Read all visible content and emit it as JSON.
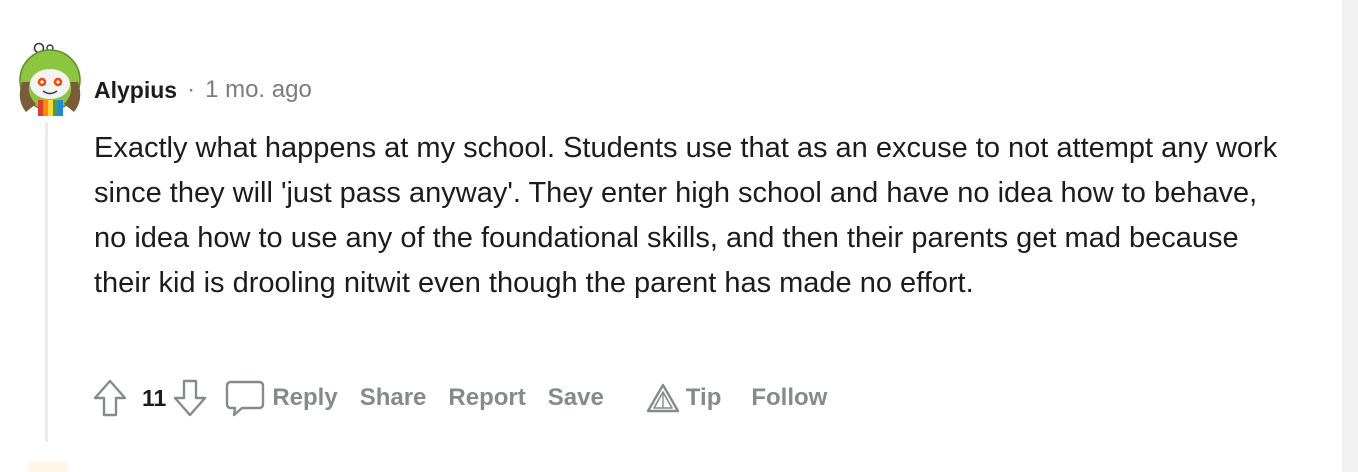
{
  "comment": {
    "author": "Alypius",
    "separator": "·",
    "time": "1 mo. ago",
    "body": "Exactly what happens at my school. Students use that as an excuse to not attempt any work since they will 'just pass anyway'. They enter high school and have no idea how to behave, no idea how to use any of the foundational skills, and then their parents get mad because their kid is drooling nitwit even though the parent has made no effort.",
    "score": "11",
    "actions": {
      "reply": "Reply",
      "share": "Share",
      "report": "Report",
      "save": "Save",
      "tip": "Tip",
      "follow": "Follow"
    }
  },
  "icons": {
    "avatar": "snoo-avatar-icon",
    "upvote": "upvote-arrow-icon",
    "downvote": "downvote-arrow-icon",
    "reply": "speech-bubble-icon",
    "tip": "triangle-tip-icon"
  },
  "colors": {
    "text": "#1c1c1c",
    "muted": "#878a8c",
    "meta": "#7c7c7c",
    "avatar_green": "#7bbf3a",
    "snoo_orange": "#ff4500"
  }
}
